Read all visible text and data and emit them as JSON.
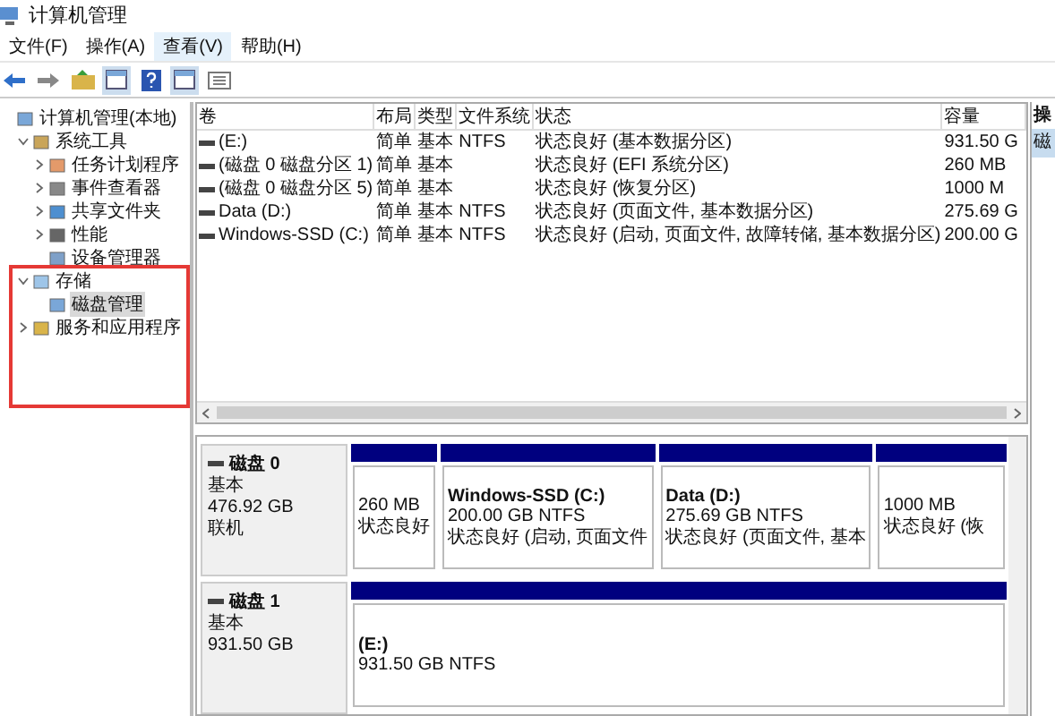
{
  "window": {
    "title": "计算机管理"
  },
  "menu": [
    {
      "label": "文件(F)",
      "selected": false
    },
    {
      "label": "操作(A)",
      "selected": false
    },
    {
      "label": "查看(V)",
      "selected": true
    },
    {
      "label": "帮助(H)",
      "selected": false
    }
  ],
  "tree": [
    {
      "label": "计算机管理(本地)",
      "children": [
        {
          "label": "系统工具",
          "expanded": true,
          "children": [
            {
              "label": "任务计划程序",
              "expanded": false,
              "selected": false
            },
            {
              "label": "事件查看器",
              "expanded": false,
              "selected": false
            },
            {
              "label": "共享文件夹",
              "expanded": false,
              "selected": false
            },
            {
              "label": "性能",
              "expanded": false,
              "selected": false
            },
            {
              "label": "设备管理器",
              "selected": false
            }
          ]
        },
        {
          "label": "存储",
          "expanded": true,
          "children": [
            {
              "label": "磁盘管理",
              "selected": true
            }
          ]
        },
        {
          "label": "服务和应用程序",
          "expanded": false
        }
      ]
    }
  ],
  "table": {
    "columns": [
      "卷",
      "布局",
      "类型",
      "文件系统",
      "状态",
      "容量"
    ],
    "rows": [
      [
        "(E:)",
        "简单",
        "基本",
        "NTFS",
        "状态良好 (基本数据分区)",
        "931.50 G"
      ],
      [
        "(磁盘 0 磁盘分区 1)",
        "简单",
        "基本",
        "",
        "状态良好 (EFI 系统分区)",
        "260 MB"
      ],
      [
        "(磁盘 0 磁盘分区 5)",
        "简单",
        "基本",
        "",
        "状态良好 (恢复分区)",
        "1000 M"
      ],
      [
        "Data (D:)",
        "简单",
        "基本",
        "NTFS",
        "状态良好 (页面文件, 基本数据分区)",
        "275.69 G"
      ],
      [
        "Windows-SSD (C:)",
        "简单",
        "基本",
        "NTFS",
        "状态良好 (启动, 页面文件, 故障转储, 基本数据分区)",
        "200.00 G"
      ]
    ]
  },
  "actions": {
    "title": "操",
    "items": [
      "磁"
    ]
  },
  "disks": [
    {
      "name": "磁盘 0",
      "type": "基本",
      "size": "476.92 GB",
      "status": "联机",
      "partitions": [
        {
          "size": "260 MB",
          "status": "状态良好"
        },
        {
          "name": "Windows-SSD  (C:)",
          "size": "200.00 GB NTFS",
          "status": "状态良好 (启动, 页面文件"
        },
        {
          "name": "Data  (D:)",
          "size": "275.69 GB NTFS",
          "status": "状态良好 (页面文件, 基本"
        },
        {
          "size": "1000 MB",
          "status": "状态良好 (恢"
        }
      ]
    },
    {
      "name": "磁盘 1",
      "type": "基本",
      "size": "931.50 GB",
      "partitions": [
        {
          "name": "(E:)",
          "size": "931.50 GB NTFS"
        }
      ]
    }
  ]
}
